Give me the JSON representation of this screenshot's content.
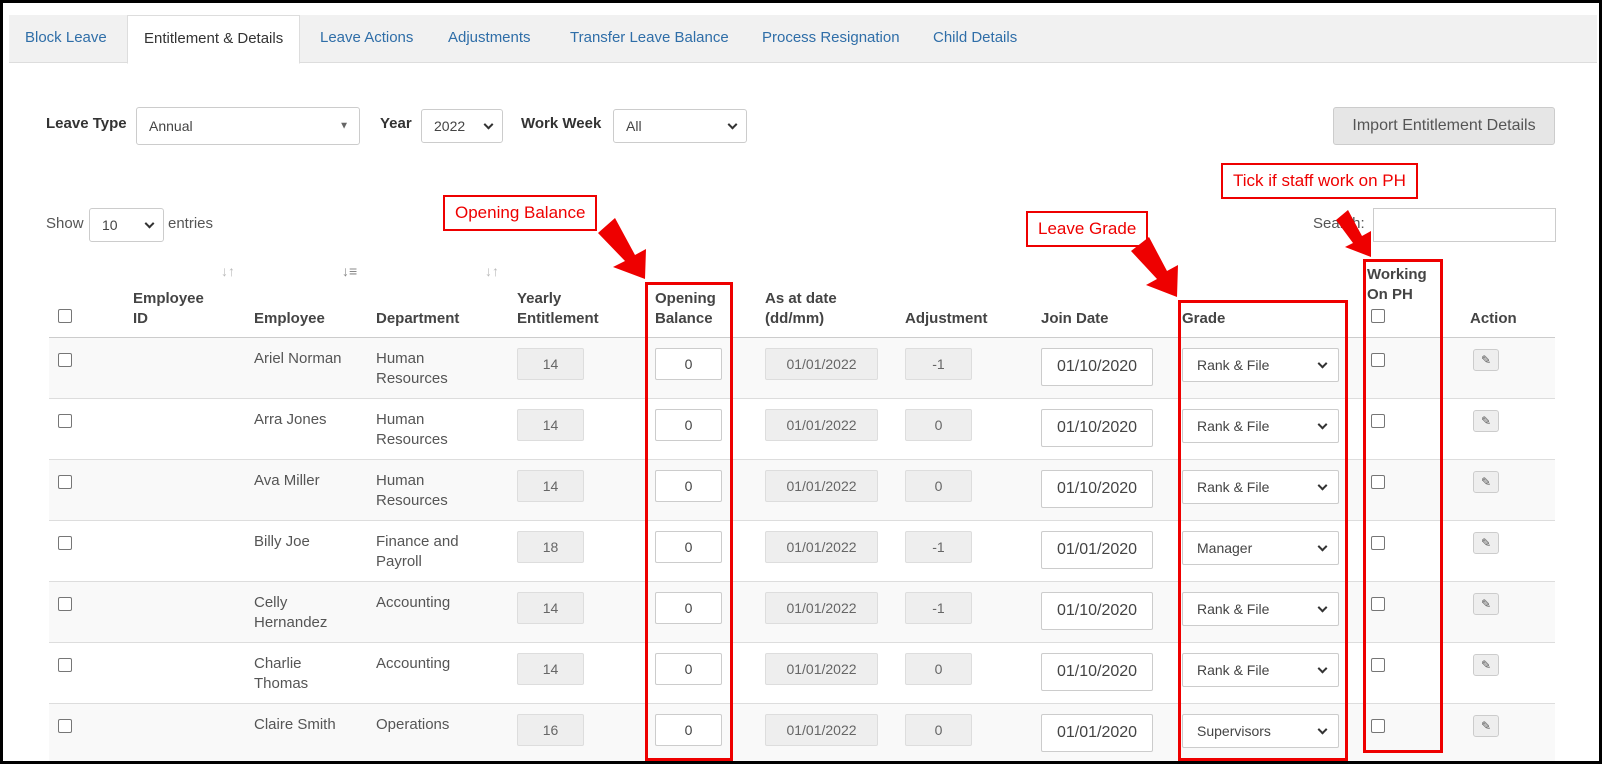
{
  "tabs": [
    {
      "label": "Block Leave",
      "active": false
    },
    {
      "label": "Entitlement & Details",
      "active": true
    },
    {
      "label": "Leave Actions",
      "active": false
    },
    {
      "label": "Adjustments",
      "active": false
    },
    {
      "label": "Transfer Leave Balance",
      "active": false
    },
    {
      "label": "Process Resignation",
      "active": false
    },
    {
      "label": "Child Details",
      "active": false
    }
  ],
  "filters": {
    "leave_type_label": "Leave Type",
    "leave_type_value": "Annual",
    "year_label": "Year",
    "year_value": "2022",
    "work_week_label": "Work Week",
    "work_week_value": "All",
    "import_button": "Import Entitlement Details"
  },
  "table_controls": {
    "show_label": "Show",
    "entries_value": "10",
    "entries_label": "entries",
    "search_label": "Search:"
  },
  "columns": {
    "employee_id": [
      "Employee",
      "ID"
    ],
    "employee": "Employee",
    "department": "Department",
    "yearly_entitlement": [
      "Yearly",
      "Entitlement"
    ],
    "opening_balance": [
      "Opening",
      "Balance"
    ],
    "as_at_date": [
      "As at date",
      "(dd/mm)"
    ],
    "adjustment": "Adjustment",
    "join_date": "Join Date",
    "grade": "Grade",
    "working_on_ph": [
      "Working",
      "On PH"
    ],
    "action": "Action"
  },
  "rows": [
    {
      "employee": [
        "Ariel Norman"
      ],
      "department": [
        "Human",
        "Resources"
      ],
      "entitlement": "14",
      "opening": "0",
      "as_at": "01/01/2022",
      "adjustment": "-1",
      "join_date": "01/10/2020",
      "grade": "Rank & File"
    },
    {
      "employee": [
        "Arra Jones"
      ],
      "department": [
        "Human",
        "Resources"
      ],
      "entitlement": "14",
      "opening": "0",
      "as_at": "01/01/2022",
      "adjustment": "0",
      "join_date": "01/10/2020",
      "grade": "Rank & File"
    },
    {
      "employee": [
        "Ava Miller"
      ],
      "department": [
        "Human",
        "Resources"
      ],
      "entitlement": "14",
      "opening": "0",
      "as_at": "01/01/2022",
      "adjustment": "0",
      "join_date": "01/10/2020",
      "grade": "Rank & File"
    },
    {
      "employee": [
        "Billy Joe"
      ],
      "department": [
        "Finance and",
        "Payroll"
      ],
      "entitlement": "18",
      "opening": "0",
      "as_at": "01/01/2022",
      "adjustment": "-1",
      "join_date": "01/01/2020",
      "grade": "Manager"
    },
    {
      "employee": [
        "Celly",
        "Hernandez"
      ],
      "department": [
        "Accounting"
      ],
      "entitlement": "14",
      "opening": "0",
      "as_at": "01/01/2022",
      "adjustment": "-1",
      "join_date": "01/10/2020",
      "grade": "Rank & File"
    },
    {
      "employee": [
        "Charlie",
        "Thomas"
      ],
      "department": [
        "Accounting"
      ],
      "entitlement": "14",
      "opening": "0",
      "as_at": "01/01/2022",
      "adjustment": "0",
      "join_date": "01/10/2020",
      "grade": "Rank & File"
    },
    {
      "employee": [
        "Claire Smith"
      ],
      "department": [
        "Operations"
      ],
      "entitlement": "16",
      "opening": "0",
      "as_at": "01/01/2022",
      "adjustment": "0",
      "join_date": "01/01/2020",
      "grade": "Supervisors"
    }
  ],
  "annotations": {
    "opening_balance": "Opening Balance",
    "leave_grade": "Leave Grade",
    "working_ph": "Tick if staff work on PH",
    "color": "#e00000"
  },
  "icons": {
    "edit": "pencil-icon",
    "sort": "sort-icon"
  }
}
